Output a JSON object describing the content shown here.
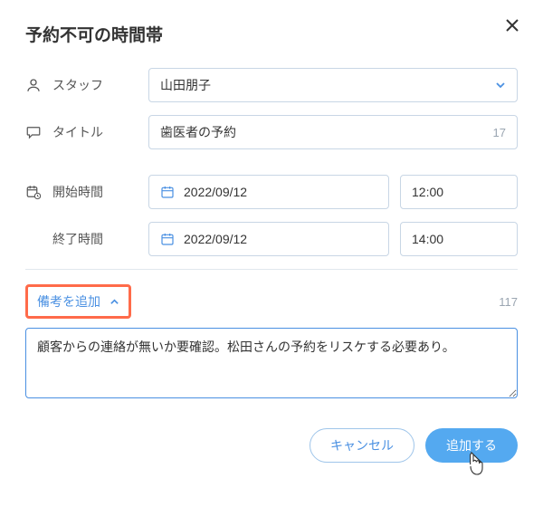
{
  "header": {
    "title": "予約不可の時間帯"
  },
  "fields": {
    "staff": {
      "label": "スタッフ",
      "value": "山田朋子"
    },
    "titleField": {
      "label": "タイトル",
      "value": "歯医者の予約",
      "count": "17"
    },
    "start": {
      "label": "開始時間",
      "date": "2022/09/12",
      "time": "12:00"
    },
    "end": {
      "label": "終了時間",
      "date": "2022/09/12",
      "time": "14:00"
    }
  },
  "remarks": {
    "toggle": "備考を追加",
    "count": "117",
    "text": "顧客からの連絡が無いか要確認。松田さんの予約をリスケする必要あり。"
  },
  "footer": {
    "cancel": "キャンセル",
    "submit": "追加する"
  }
}
